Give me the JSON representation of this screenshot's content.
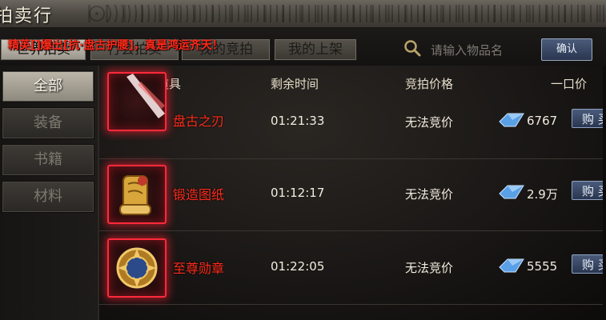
{
  "window": {
    "title": "拍卖行"
  },
  "announcement": "精英[]爆出[抗·盘古护腰]，真是鸿运齐天！",
  "tabs": [
    {
      "label": "世界拍卖"
    },
    {
      "label": "行会拍卖"
    },
    {
      "label": "我的竞拍"
    },
    {
      "label": "我的上架"
    }
  ],
  "search": {
    "placeholder": "请输入物品名",
    "confirm_label": "确认"
  },
  "sidebar": {
    "items": [
      {
        "label": "全部"
      },
      {
        "label": "装备"
      },
      {
        "label": "书籍"
      },
      {
        "label": "材料"
      }
    ]
  },
  "table": {
    "headers": {
      "item": "竞拍道具",
      "time": "剩余时间",
      "bid_price": "竞拍价格",
      "buyout": "一口价"
    },
    "rows": [
      {
        "name": "盘古之刃",
        "time": "01:21:33",
        "bid": "无法竞价",
        "price": "6767",
        "buy_label": "购 买",
        "icon": "blade-icon"
      },
      {
        "name": "锻造图纸",
        "time": "01:12:17",
        "bid": "无法竞价",
        "price": "2.9万",
        "buy_label": "购 买",
        "icon": "scroll-icon"
      },
      {
        "name": "至尊勋章",
        "time": "01:22:05",
        "bid": "无法竞价",
        "price": "5555",
        "buy_label": "购 买",
        "icon": "medal-icon"
      }
    ]
  },
  "colors": {
    "accent_red": "#ff2a1a",
    "button_blue": "#2a3650"
  }
}
